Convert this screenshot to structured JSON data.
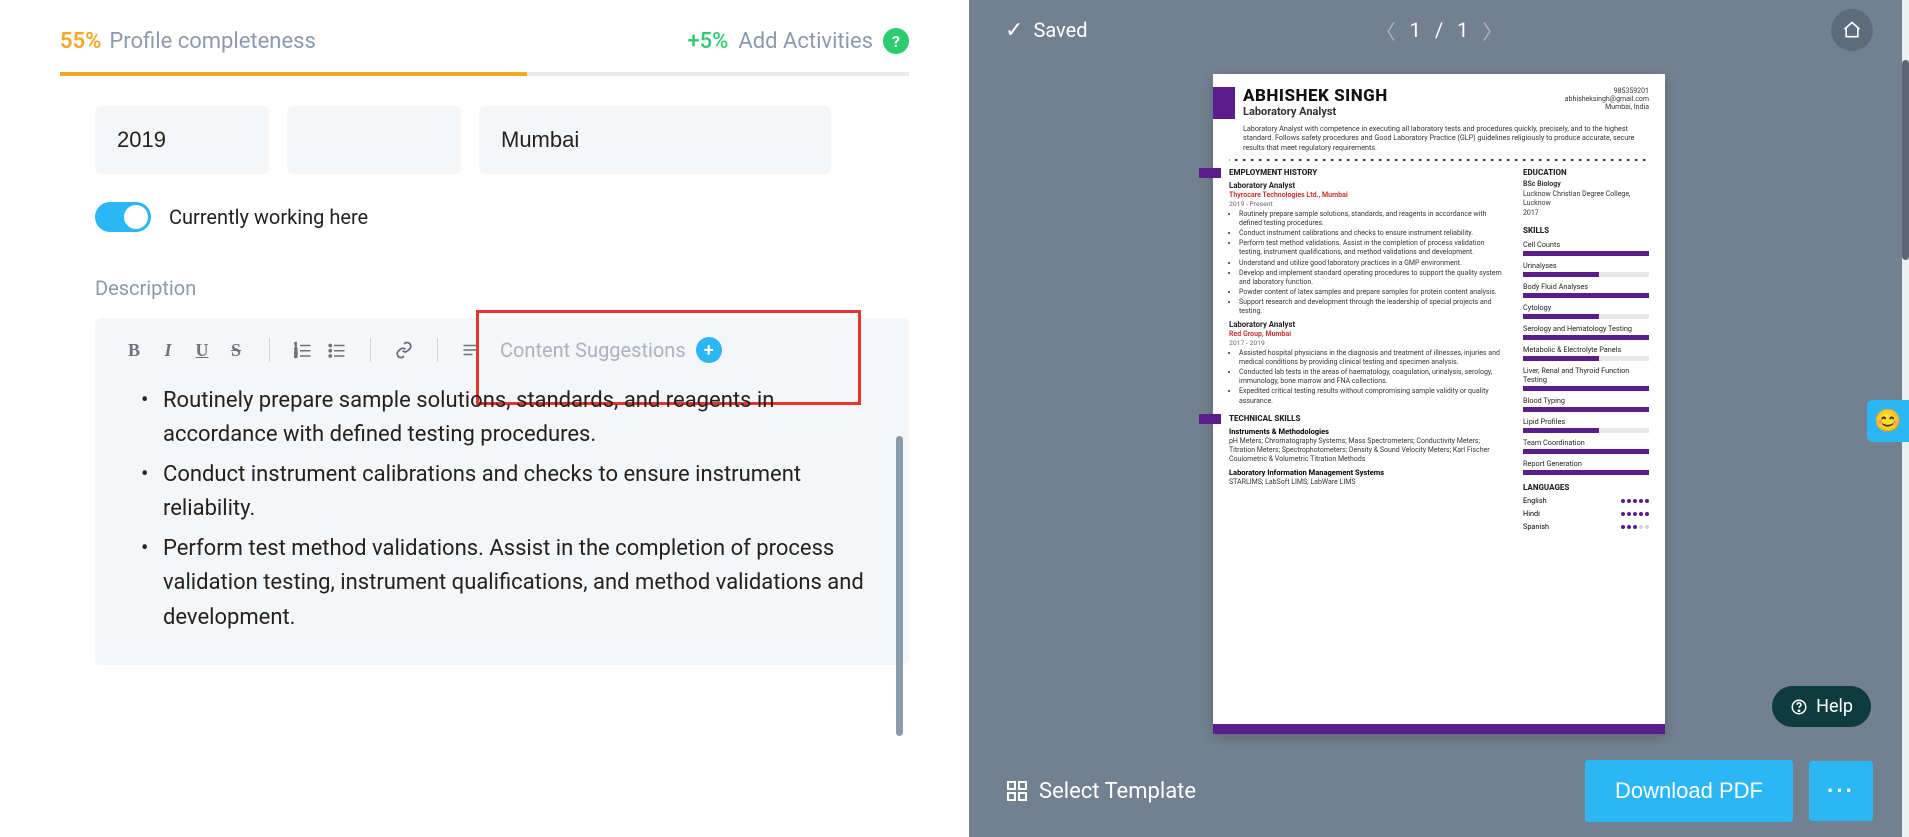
{
  "header": {
    "pct": "55%",
    "completeness_label": "Profile completeness",
    "plus_pct": "+5%",
    "activities_label": "Add Activities",
    "help_glyph": "?"
  },
  "form": {
    "year": "2019",
    "blank": "",
    "city": "Mumbai",
    "toggle_label": "Currently working here",
    "description_label": "Description",
    "content_suggestions": "Content Suggestions",
    "bullets": [
      "Routinely prepare sample solutions, standards, and reagents in accordance with defined testing procedures.",
      "Conduct instrument calibrations and checks to ensure instrument reliability.",
      "Perform test method validations. Assist in the completion of process validation testing, instrument qualifications, and method validations and development."
    ]
  },
  "preview": {
    "saved_label": "Saved",
    "page_current": "1",
    "page_sep": "/",
    "page_total": "1"
  },
  "resume": {
    "name": "ABHISHEK SINGH",
    "role": "Laboratory Analyst",
    "phone": "985359201",
    "email": "abhisheksingh@gmail.com",
    "location": "Mumbai, India",
    "summary": "Laboratory Analyst with competence in executing all laboratory tests and procedures quickly, precisely, and to the highest standard. Follows safety procedures and Good Laboratory Practice (GLP) guidelines religiously to produce accurate, secure results that meet regulatory requirements.",
    "sections": {
      "employment": "EMPLOYMENT HISTORY",
      "technical": "TECHNICAL SKILLS",
      "education": "EDUCATION",
      "skills": "SKILLS",
      "languages": "LANGUAGES"
    },
    "jobs": [
      {
        "title": "Laboratory Analyst",
        "sub": "Thyrocare Technologies Ltd., Mumbai",
        "dates": "2019 - Present",
        "bullets": [
          "Routinely prepare sample solutions, standards, and reagents in accordance with defined testing procedures.",
          "Conduct instrument calibrations and checks to ensure instrument reliability.",
          "Perform test method validations. Assist in the completion of process validation testing, instrument qualifications, and method validations and development.",
          "Understand and utilize good laboratory practices in a GMP environment.",
          "Develop and implement standard operating procedures to support the quality system and laboratory function.",
          "Powder content of latex samples and prepare samples for protein content analysis.",
          "Support research and development through the leadership of special projects and testing."
        ]
      },
      {
        "title": "Laboratory Analyst",
        "sub": "Red Group, Mumbai",
        "dates": "2017 - 2019",
        "bullets": [
          "Assisted hospital physicians in the diagnosis and treatment of illnesses, injuries and medical conditions by providing clinical testing and specimen analysis.",
          "Conducted lab tests in the areas of haematology, coagulation, urinalysis, serology, immunology, bone marrow and FNA collections.",
          "Expedited critical testing results without compromising sample validity or quality assurance."
        ]
      }
    ],
    "technical": {
      "instruments_head": "Instruments & Methodologies",
      "instruments_body": "pH Meters; Chromatography Systems; Mass Spectrometers; Conductivity Meters; Titration Meters; Spectrophotometers; Density & Sound Velocity Meters; Karl Fischer Coulometric & Volumetric Titration Methods",
      "lims_head": "Laboratory Information Management Systems",
      "lims_body": "STARLIMS; LabSoft LIMS; LabWare LIMS"
    },
    "education": {
      "degree": "BSc Biology",
      "school": "Lucknow Christian Degree College, Lucknow",
      "year": "2017"
    },
    "skills": [
      {
        "name": "Cell Counts",
        "pct": 100
      },
      {
        "name": "Urinalyses",
        "pct": 60
      },
      {
        "name": "Body Fluid Analyses",
        "pct": 100
      },
      {
        "name": "Cytology",
        "pct": 60
      },
      {
        "name": "Serology and Hematology Testing",
        "pct": 100
      },
      {
        "name": "Metabolic & Electrolyte Panels",
        "pct": 60
      },
      {
        "name": "Liver, Renal and Thyroid Function Testing",
        "pct": 100
      },
      {
        "name": "Blood Typing",
        "pct": 100
      },
      {
        "name": "Lipid Profiles",
        "pct": 60
      },
      {
        "name": "Team Coordination",
        "pct": 100
      },
      {
        "name": "Report Generation",
        "pct": 100
      }
    ],
    "languages": [
      {
        "name": "English",
        "level": 5
      },
      {
        "name": "Hindi",
        "level": 5
      },
      {
        "name": "Spanish",
        "level": 3
      }
    ]
  },
  "actions": {
    "select_template": "Select Template",
    "download": "Download PDF",
    "more": "···",
    "help": "Help"
  }
}
